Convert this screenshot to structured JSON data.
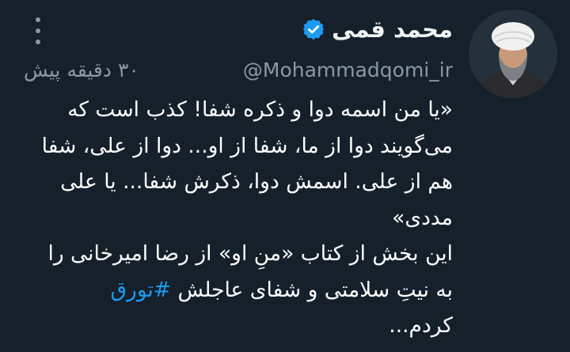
{
  "tweet": {
    "author": {
      "display_name": "محمد قمی",
      "handle": "@Mohammadqomi_ir",
      "verified": true,
      "avatar_icon": "avatar-photo-icon"
    },
    "timestamp": "۳۰ دقیقه پیش",
    "more_icon": "more-dots-icon",
    "body": {
      "lines": [
        "«یا من اسمه دوا و ذکره شفا! کذب است که",
        "می‌گویند دوا از ما، شفا از او... دوا از علی، شفا",
        "هم از علی. اسمش دوا، ذکرش شفا... یا علی",
        "مددی»",
        "این بخش از کتاب «منِ او» از رضا امیرخانی را"
      ],
      "line6_text": "به نیتِ سلامتی و شفای عاجلش ",
      "hashtag": "#تورق",
      "last_line": "کردم..."
    },
    "colors": {
      "background": "#15202b",
      "text": "#ffffff",
      "secondary": "#8b98a5",
      "accent": "#1d9bf0"
    }
  }
}
